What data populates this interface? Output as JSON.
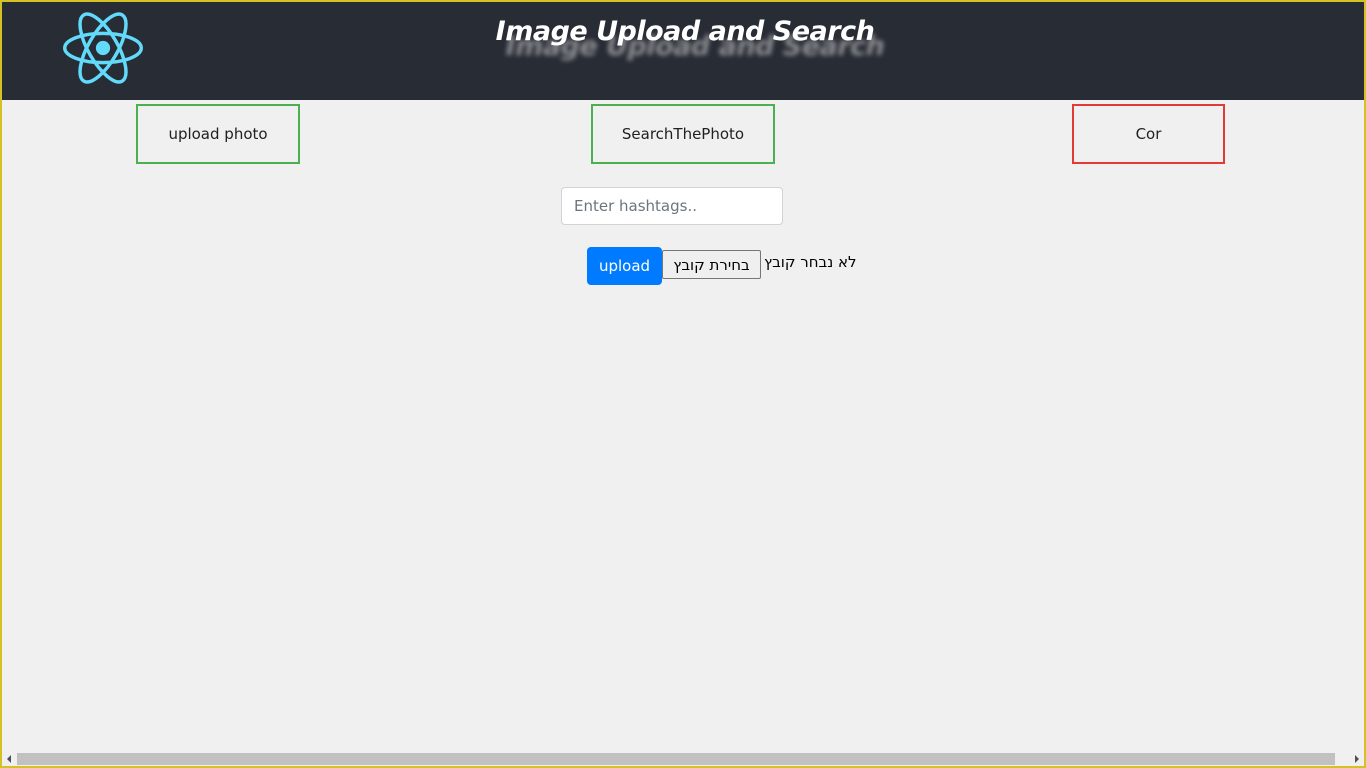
{
  "header": {
    "title": "Image Upload and Search",
    "logo_icon": "react-atom-icon",
    "logo_color": "#61dafb",
    "background": "#282c34"
  },
  "nav": {
    "upload_label": "upload photo",
    "search_label": "SearchThePhoto",
    "cor_label": "Cor"
  },
  "form": {
    "hashtags_placeholder": "Enter hashtags..",
    "hashtags_value": "",
    "upload_label": "upload",
    "choose_file_label": "בחירת קובץ",
    "file_status": "לא נבחר קובץ"
  },
  "colors": {
    "nav_green": "#4caf50",
    "nav_red": "#e53935",
    "primary_button": "#007bff",
    "page_background": "#f0f0f0"
  }
}
